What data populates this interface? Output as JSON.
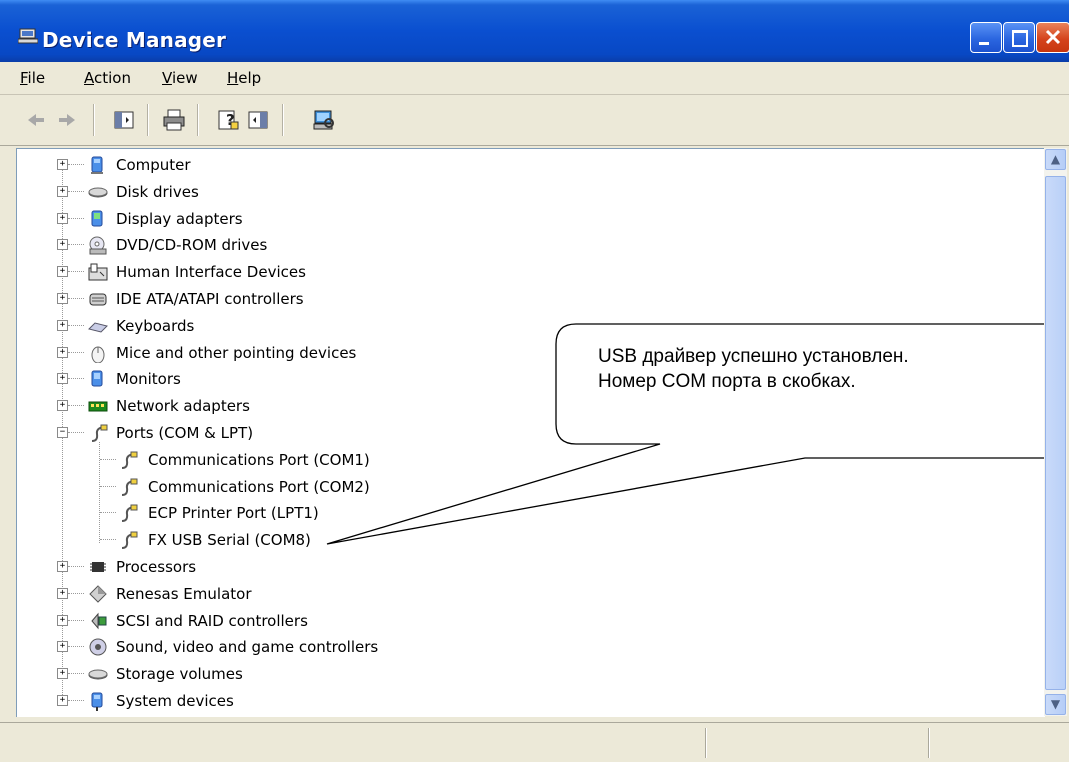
{
  "window": {
    "title": "Device Manager",
    "colors": {
      "title_bar": "#0a4fd0",
      "close": "#d5441d"
    }
  },
  "menu": [
    {
      "name": "menu-file",
      "pre": "",
      "u": "F",
      "post": "ile"
    },
    {
      "name": "menu-action",
      "pre": "",
      "u": "A",
      "post": "ction"
    },
    {
      "name": "menu-view",
      "pre": "",
      "u": "V",
      "post": "iew"
    },
    {
      "name": "menu-help",
      "pre": "",
      "u": "H",
      "post": "elp"
    }
  ],
  "toolbar": [
    "back-arrow-icon",
    "forward-arrow-icon",
    "show-hide-console-tree-icon",
    "print-icon",
    "help-icon",
    "properties-icon",
    "scan-hardware-icon"
  ],
  "tree": {
    "items": [
      {
        "label": "Computer",
        "icon": "computer-icon",
        "state": "collapsed"
      },
      {
        "label": "Disk drives",
        "icon": "disk-drive-icon",
        "state": "collapsed"
      },
      {
        "label": "Display adapters",
        "icon": "display-adapter-icon",
        "state": "collapsed"
      },
      {
        "label": "DVD/CD-ROM drives",
        "icon": "dvd-drive-icon",
        "state": "collapsed"
      },
      {
        "label": "Human Interface Devices",
        "icon": "hid-icon",
        "state": "collapsed"
      },
      {
        "label": "IDE ATA/ATAPI controllers",
        "icon": "ide-controller-icon",
        "state": "collapsed"
      },
      {
        "label": "Keyboards",
        "icon": "keyboard-icon",
        "state": "collapsed"
      },
      {
        "label": "Mice and other pointing devices",
        "icon": "mouse-icon",
        "state": "collapsed"
      },
      {
        "label": "Monitors",
        "icon": "monitor-icon",
        "state": "collapsed"
      },
      {
        "label": "Network adapters",
        "icon": "network-adapter-icon",
        "state": "collapsed"
      },
      {
        "label": "Ports (COM & LPT)",
        "icon": "port-icon",
        "state": "expanded",
        "children": [
          {
            "label": "Communications Port (COM1)",
            "icon": "port-icon"
          },
          {
            "label": "Communications Port (COM2)",
            "icon": "port-icon"
          },
          {
            "label": "ECP Printer Port (LPT1)",
            "icon": "port-icon"
          },
          {
            "label": "FX USB Serial (COM8)",
            "icon": "port-icon"
          }
        ]
      },
      {
        "label": "Processors",
        "icon": "processor-icon",
        "state": "collapsed"
      },
      {
        "label": "Renesas Emulator",
        "icon": "emulator-icon",
        "state": "collapsed"
      },
      {
        "label": "SCSI and RAID controllers",
        "icon": "scsi-icon",
        "state": "collapsed"
      },
      {
        "label": "Sound, video and game controllers",
        "icon": "sound-icon",
        "state": "collapsed"
      },
      {
        "label": "Storage volumes",
        "icon": "storage-volume-icon",
        "state": "collapsed"
      },
      {
        "label": "System devices",
        "icon": "system-device-icon",
        "state": "collapsed"
      }
    ]
  },
  "callout": {
    "line1": "USB драйвер успешно установлен.",
    "line2": "Номер COM порта в скобках."
  }
}
